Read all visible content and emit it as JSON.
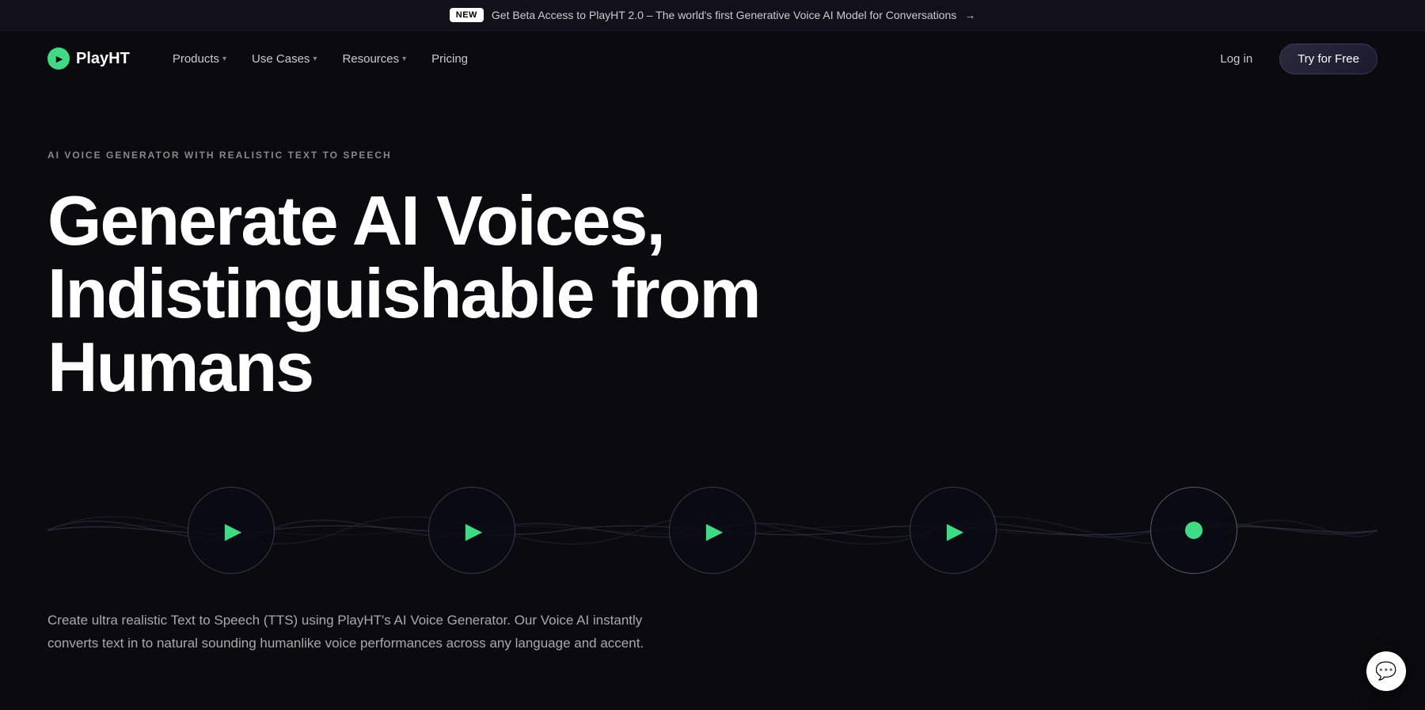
{
  "banner": {
    "badge": "NEW",
    "text": "Get Beta Access to PlayHT 2.0 – The world's first Generative Voice AI Model for Conversations",
    "arrow": "→"
  },
  "nav": {
    "logo_text": "PlayHT",
    "links": [
      {
        "label": "Products",
        "has_dropdown": true
      },
      {
        "label": "Use Cases",
        "has_dropdown": true
      },
      {
        "label": "Resources",
        "has_dropdown": true
      },
      {
        "label": "Pricing",
        "has_dropdown": false
      }
    ],
    "login_label": "Log in",
    "try_free_label": "Try for Free"
  },
  "hero": {
    "subtitle": "AI VOICE GENERATOR WITH REALISTIC TEXT TO SPEECH",
    "title_line1": "Generate AI Voices,",
    "title_line2": "Indistinguishable from Humans",
    "description": "Create ultra realistic Text to Speech (TTS) using PlayHT's AI Voice Generator. Our Voice AI instantly converts text in to natural sounding humanlike voice performances across any language and accent."
  },
  "players": [
    {
      "id": 1,
      "type": "play",
      "active": false
    },
    {
      "id": 2,
      "type": "play",
      "active": false
    },
    {
      "id": 3,
      "type": "play",
      "active": false
    },
    {
      "id": 4,
      "type": "play",
      "active": false
    },
    {
      "id": 5,
      "type": "dot",
      "active": true
    }
  ],
  "colors": {
    "accent": "#3ddc84",
    "background": "#0a0a0f",
    "banner_bg": "#12111a"
  }
}
